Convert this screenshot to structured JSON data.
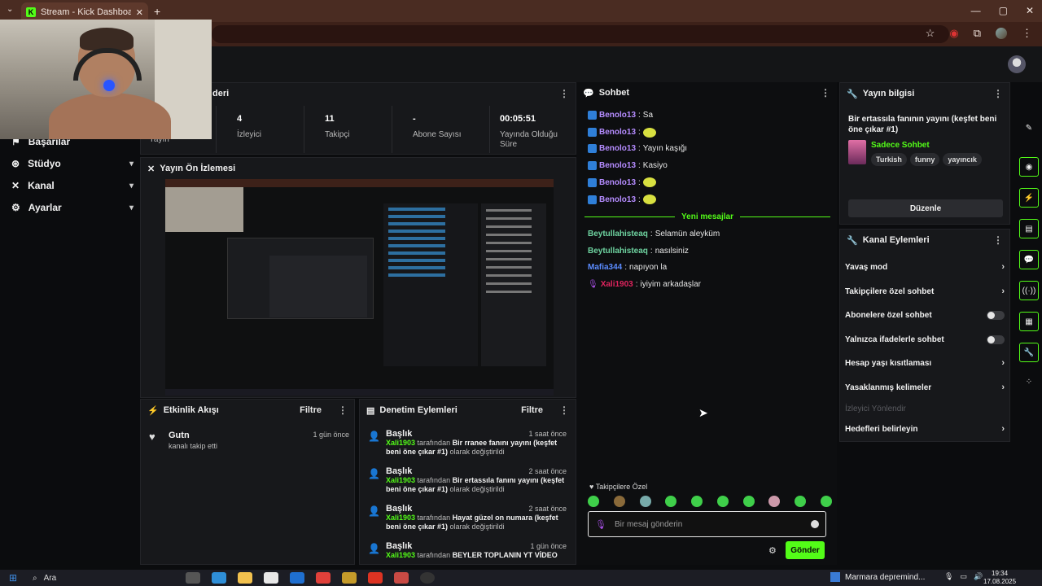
{
  "browser": {
    "tab_title": "Stream - Kick Dashboard",
    "tab_favicon": "K"
  },
  "nav": {
    "items": [
      {
        "label": "Başarılar",
        "icon": "trophy-icon",
        "expandable": false
      },
      {
        "label": "Stüdyo",
        "icon": "studio-icon",
        "expandable": true
      },
      {
        "label": "Kanal",
        "icon": "channel-icon",
        "expandable": true
      },
      {
        "label": "Ayarlar",
        "icon": "settings-icon",
        "expandable": true
      }
    ],
    "partial_label": "Yayın"
  },
  "stats": {
    "panel_title_partial": "deri",
    "items": [
      {
        "value": "4",
        "label": "İzleyici"
      },
      {
        "value": "11",
        "label": "Takipçi"
      },
      {
        "value": "-",
        "label": "Abone Sayısı"
      },
      {
        "value": "00:05:51",
        "label": "Yayında Olduğu Süre"
      }
    ]
  },
  "preview": {
    "title": "Yayın Ön İzlemesi"
  },
  "activity": {
    "title": "Etkinlik Akışı",
    "filter": "Filtre",
    "events": [
      {
        "name": "Gutn",
        "detail": "kanalı takip etti",
        "time": "1 gün önce"
      }
    ]
  },
  "moderation": {
    "title": "Denetim Eylemleri",
    "filter": "Filtre",
    "rows": [
      {
        "heading": "Başlık",
        "time": "1 saat önce",
        "user": "Xali1903",
        "by": "tarafından",
        "text": "Bir rranee fanını yayını (keşfet beni öne çıkar #1)",
        "suffix": "olarak değiştirildi"
      },
      {
        "heading": "Başlık",
        "time": "2 saat önce",
        "user": "Xali1903",
        "by": "tarafından",
        "text": "Bir ertassıla fanını yayını (keşfet beni öne çıkar #1)",
        "suffix": "olarak değiştirildi"
      },
      {
        "heading": "Başlık",
        "time": "2 saat önce",
        "user": "Xali1903",
        "by": "tarafından",
        "text": "Hayat güzel on numara (keşfet beni öne çıkar #1)",
        "suffix": "olarak değiştirildi"
      },
      {
        "heading": "Başlık",
        "time": "1 gün önce",
        "user": "Xali1903",
        "by": "tarafından",
        "text": "BEYLER TOPLANIN YT VİDEO",
        "suffix": ""
      }
    ]
  },
  "chat": {
    "title": "Sohbet",
    "messages": [
      {
        "user": "Benolo13",
        "text": "Sa",
        "color": "#b58cff",
        "badge": true,
        "emote": false
      },
      {
        "user": "Benolo13",
        "text": "",
        "color": "#b58cff",
        "badge": true,
        "emote": true
      },
      {
        "user": "Benolo13",
        "text": "Yayın kaşığı",
        "color": "#b58cff",
        "badge": true,
        "emote": false
      },
      {
        "user": "Benolo13",
        "text": "Kasiyo",
        "color": "#b58cff",
        "badge": true,
        "emote": false
      },
      {
        "user": "Benolo13",
        "text": "",
        "color": "#b58cff",
        "badge": true,
        "emote": true
      },
      {
        "user": "Benolo13",
        "text": "",
        "color": "#b58cff",
        "badge": true,
        "emote": true
      }
    ],
    "new_messages_label": "Yeni mesajlar",
    "new_messages": [
      {
        "user": "Beytullahisteaq",
        "text": "Selamün aleyküm",
        "color": "#6ed3a0"
      },
      {
        "user": "Beytullahisteaq",
        "text": "nasılsiniz",
        "color": "#6ed3a0"
      },
      {
        "user": "Mafia344",
        "text": "napıyon la",
        "color": "#5b8cff"
      },
      {
        "user": "Xali1903",
        "text": "iyiyim arkadaşlar",
        "color": "#e0245e"
      }
    ],
    "followers_only": "Takipçilere Özel",
    "input_placeholder": "Bir mesaj gönderin",
    "send_label": "Gönder",
    "accent": "#53fc18"
  },
  "stream_info": {
    "panel_title": "Yayın bilgisi",
    "title": "Bir ertassıla fanının yayını (keşfet beni öne çıkar #1)",
    "category": "Sadece Sohbet",
    "tags": [
      "Turkish",
      "funny",
      "yayıncık"
    ],
    "edit_label": "Düzenle"
  },
  "channel_actions": {
    "title": "Kanal Eylemleri",
    "items": [
      {
        "label": "Yavaş mod",
        "control": "arrow"
      },
      {
        "label": "Takipçilere özel sohbet",
        "control": "arrow"
      },
      {
        "label": "Abonelere özel sohbet",
        "control": "toggle",
        "on": false
      },
      {
        "label": "Yalnızca ifadelerle sohbet",
        "control": "toggle",
        "on": false
      },
      {
        "label": "Hesap yaşı kısıtlaması",
        "control": "arrow"
      },
      {
        "label": "Yasaklanmış kelimeler",
        "control": "arrow"
      },
      {
        "label": "İzleyici Yönlendir",
        "control": "none",
        "disabled": true
      },
      {
        "label": "Hedefleri belirleyin",
        "control": "arrow"
      }
    ]
  },
  "taskbar": {
    "search_label": "Ara",
    "news": "Marmara depremind...",
    "time": "19:34",
    "date": "17.08.2025"
  }
}
